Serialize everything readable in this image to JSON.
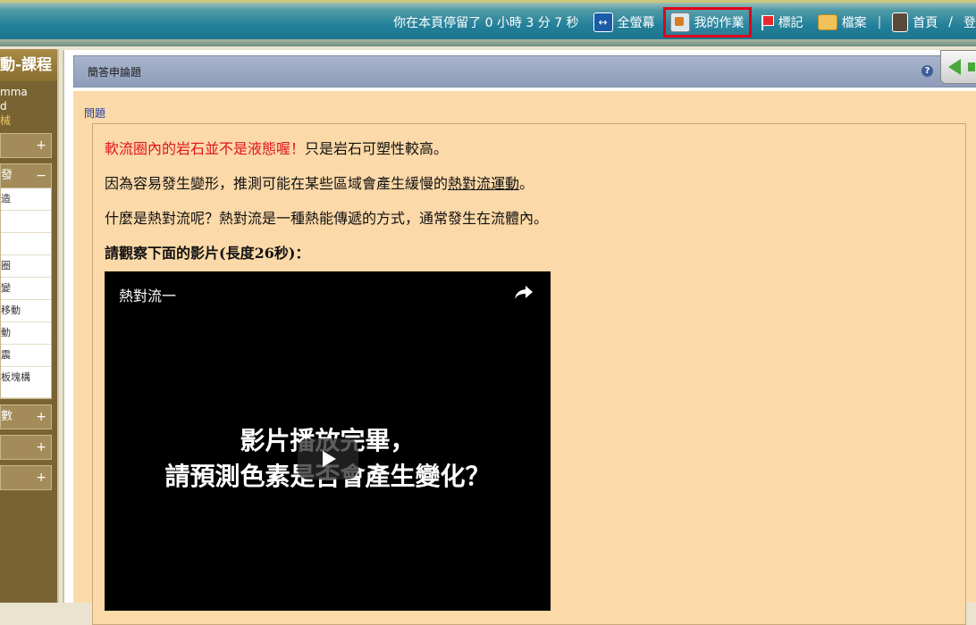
{
  "topbar": {
    "timer": "你在本頁停留了 0 小時 3 分 7 秒",
    "buttons": {
      "fullscreen": "全螢幕",
      "my_work": "我的作業",
      "bookmark": "標記",
      "files": "檔案",
      "home": "首頁",
      "logout_partial": "登"
    },
    "separator": "/"
  },
  "sidebar": {
    "title": "動-課程",
    "user_name": "mma",
    "user_line2": "d",
    "user_sub": "械",
    "blocks": [
      {
        "label": "",
        "toggle": "+"
      },
      {
        "label": "發",
        "toggle": "−"
      },
      {
        "label": "數",
        "toggle": "+"
      },
      {
        "label": "",
        "toggle": "+"
      },
      {
        "label": "",
        "toggle": "+"
      }
    ],
    "items": [
      "造",
      "",
      "",
      "圈",
      "變",
      "移動",
      "動",
      "震",
      "板塊構"
    ]
  },
  "panel": {
    "title": "簡答申論題",
    "help": "?"
  },
  "content": {
    "question_label": "問題",
    "line1_red": "軟流圈內的岩石並不是液態喔！",
    "line1_rest": "只是岩石可塑性較高。",
    "line2_a": "因為容易發生變形，推測可能在某些區域會產生緩慢的",
    "line2_b": "熱對流運動",
    "line2_c": "。",
    "line3": "什麼是熱對流呢？熱對流是一種熱能傳遞的方式，通常發生在流體內。",
    "line4": "請觀察下面的影片(長度26秒)：",
    "video": {
      "title": "熱對流一",
      "overlay_line1": "影片播放完畢，",
      "overlay_line2": "請預測色素是否會產生變化？"
    }
  }
}
